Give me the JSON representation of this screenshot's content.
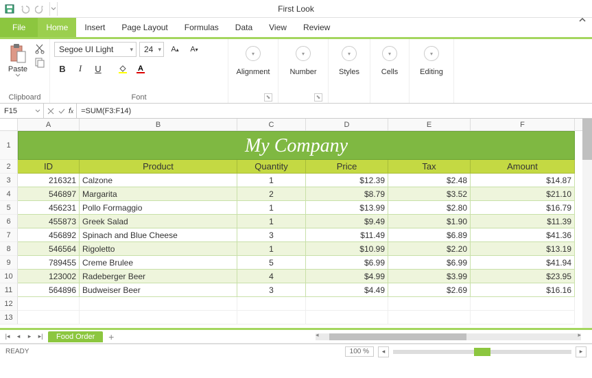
{
  "window": {
    "title": "First Look"
  },
  "tabs": {
    "file": "File",
    "items": [
      "Home",
      "Insert",
      "Page Layout",
      "Formulas",
      "Data",
      "View",
      "Review"
    ],
    "active": 0
  },
  "ribbon": {
    "clipboard": {
      "paste": "Paste",
      "label": "Clipboard"
    },
    "font": {
      "name": "Segoe UI Light",
      "size": "24",
      "label": "Font"
    },
    "alignment": "Alignment",
    "number": "Number",
    "styles": "Styles",
    "cells": "Cells",
    "editing": "Editing"
  },
  "formula_bar": {
    "name_box": "F15",
    "formula": "=SUM(F3:F14)"
  },
  "grid": {
    "columns": [
      "A",
      "B",
      "C",
      "D",
      "E",
      "F"
    ],
    "title": "My Company",
    "headers": [
      "ID",
      "Product",
      "Quantity",
      "Price",
      "Tax",
      "Amount"
    ],
    "rows": [
      {
        "id": "216321",
        "product": "Calzone",
        "qty": "1",
        "price": "$12.39",
        "tax": "$2.48",
        "amount": "$14.87"
      },
      {
        "id": "546897",
        "product": "Margarita",
        "qty": "2",
        "price": "$8.79",
        "tax": "$3.52",
        "amount": "$21.10"
      },
      {
        "id": "456231",
        "product": "Pollo Formaggio",
        "qty": "1",
        "price": "$13.99",
        "tax": "$2.80",
        "amount": "$16.79"
      },
      {
        "id": "455873",
        "product": "Greek Salad",
        "qty": "1",
        "price": "$9.49",
        "tax": "$1.90",
        "amount": "$11.39"
      },
      {
        "id": "456892",
        "product": "Spinach and Blue Cheese",
        "qty": "3",
        "price": "$11.49",
        "tax": "$6.89",
        "amount": "$41.36"
      },
      {
        "id": "546564",
        "product": "Rigoletto",
        "qty": "1",
        "price": "$10.99",
        "tax": "$2.20",
        "amount": "$13.19"
      },
      {
        "id": "789455",
        "product": "Creme Brulee",
        "qty": "5",
        "price": "$6.99",
        "tax": "$6.99",
        "amount": "$41.94"
      },
      {
        "id": "123002",
        "product": "Radeberger Beer",
        "qty": "4",
        "price": "$4.99",
        "tax": "$3.99",
        "amount": "$23.95"
      },
      {
        "id": "564896",
        "product": "Budweiser Beer",
        "qty": "3",
        "price": "$4.49",
        "tax": "$2.69",
        "amount": "$16.16"
      }
    ]
  },
  "sheet": {
    "name": "Food Order"
  },
  "status": {
    "ready": "READY",
    "zoom": "100 %"
  }
}
